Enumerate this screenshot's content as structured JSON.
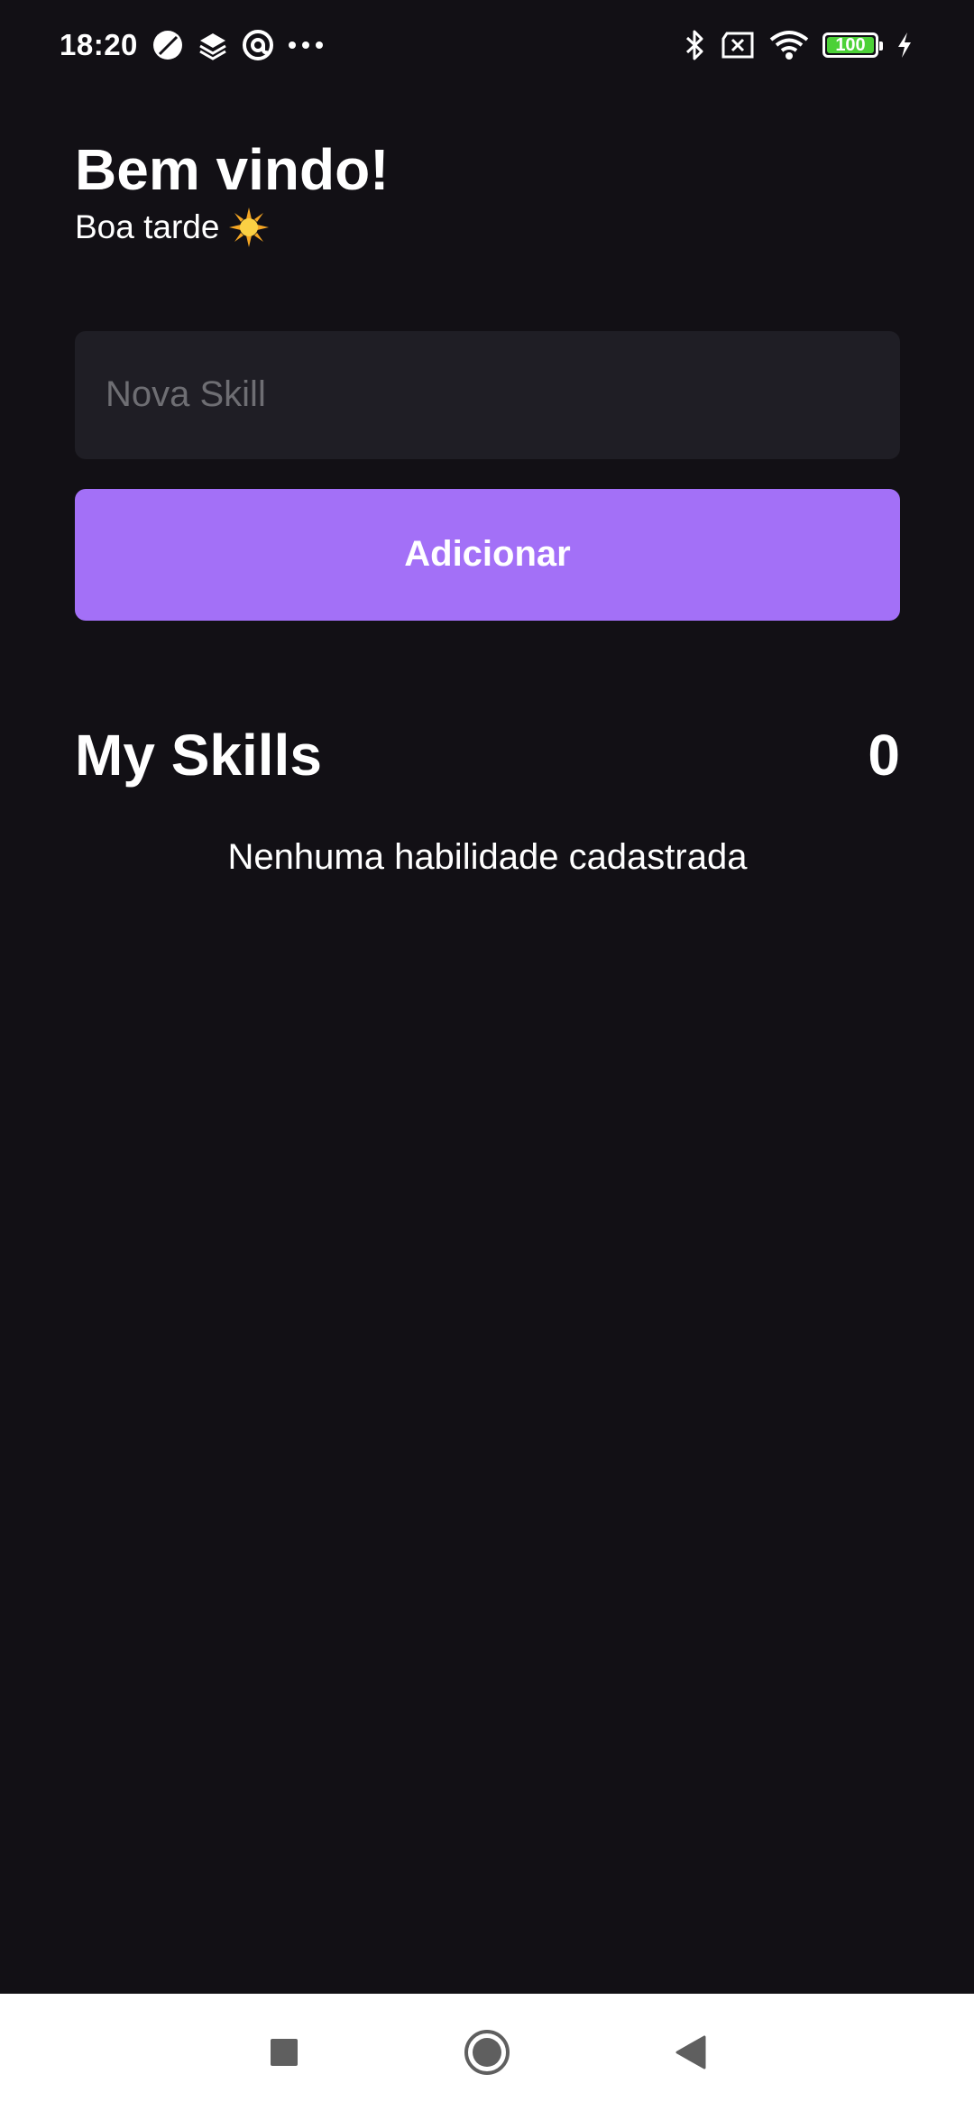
{
  "status_bar": {
    "time": "18:20",
    "battery_level": "100",
    "icons_left": [
      "moon-icon",
      "layers-icon",
      "at-sign-icon",
      "more-dots-icon"
    ],
    "icons_right": [
      "bluetooth-icon",
      "no-sim-icon",
      "wifi-icon",
      "battery-icon",
      "charging-icon"
    ]
  },
  "header": {
    "title": "Bem vindo!",
    "subtitle": "Boa tarde",
    "subtitle_icon": "sun-icon"
  },
  "form": {
    "input_placeholder": "Nova Skill",
    "input_value": "",
    "add_button_label": "Adicionar"
  },
  "skills": {
    "title": "My Skills",
    "count": "0",
    "empty_message": "Nenhuma habilidade cadastrada"
  },
  "nav_bar": {
    "buttons": [
      "recents-square-icon",
      "home-circle-icon",
      "back-triangle-icon"
    ]
  },
  "colors": {
    "background": "#121015",
    "input_background": "#1f1e25",
    "accent": "#a370f7",
    "battery_green": "#4cd137"
  }
}
